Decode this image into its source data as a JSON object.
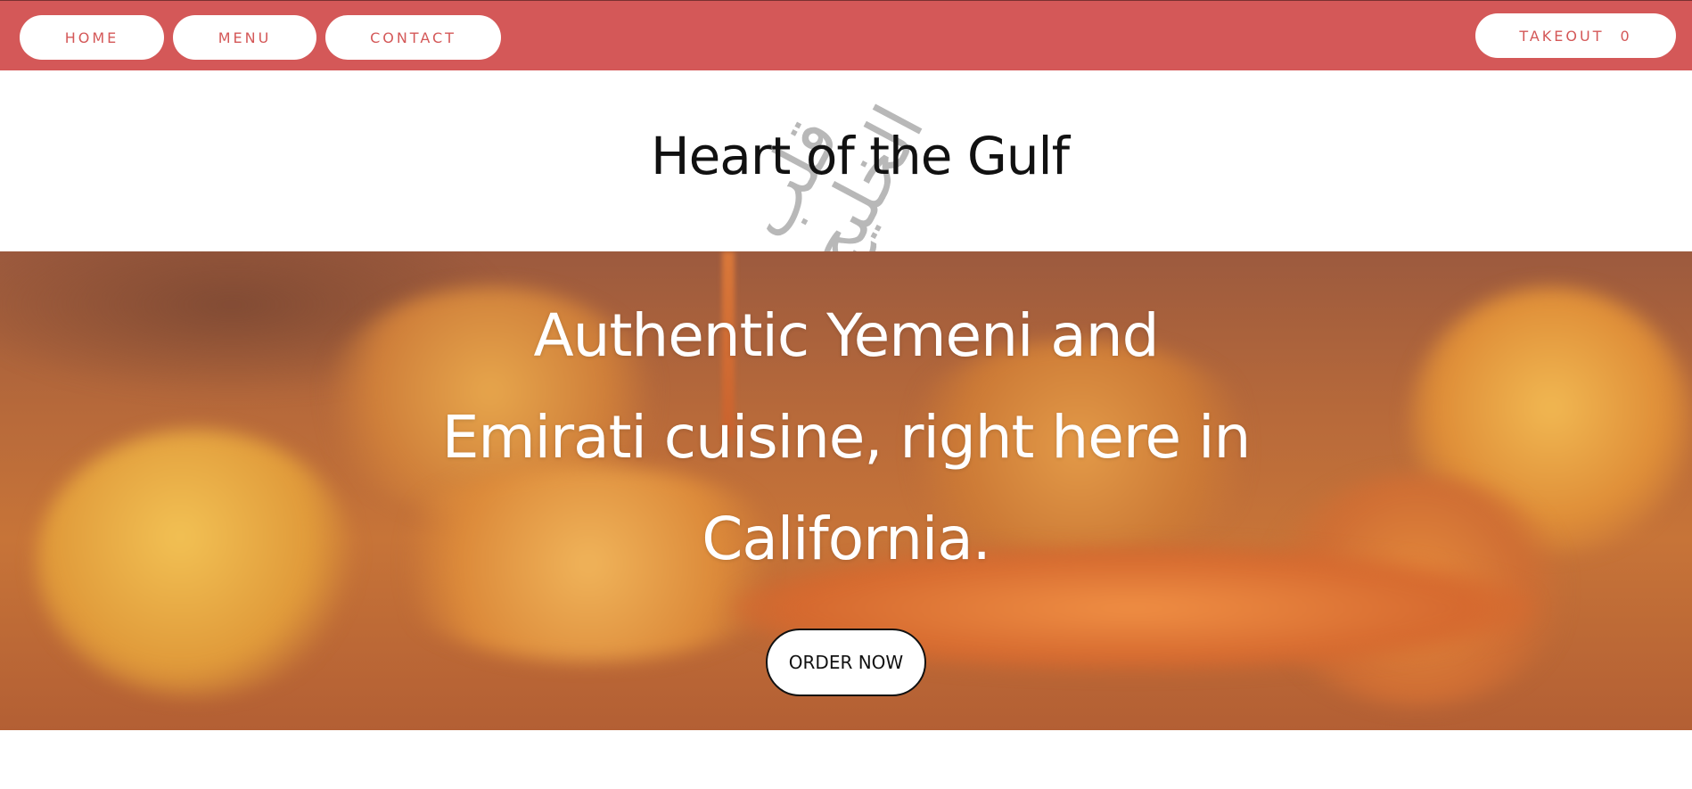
{
  "nav": {
    "items": [
      {
        "label": "HOME"
      },
      {
        "label": "MENU"
      },
      {
        "label": "CONTACT"
      }
    ],
    "takeout": {
      "label": "TAKEOUT",
      "count": "0"
    }
  },
  "brand": {
    "name": "Heart of the Gulf",
    "arabic_name": "قلب الخليج"
  },
  "hero": {
    "headline_line1": "Authentic Yemeni and",
    "headline_line2": "Emirati cuisine, right here in",
    "headline_line3": "California.",
    "cta_label": "ORDER NOW"
  },
  "colors": {
    "accent": "#d45858",
    "text_dark": "#111111",
    "white": "#ffffff"
  }
}
